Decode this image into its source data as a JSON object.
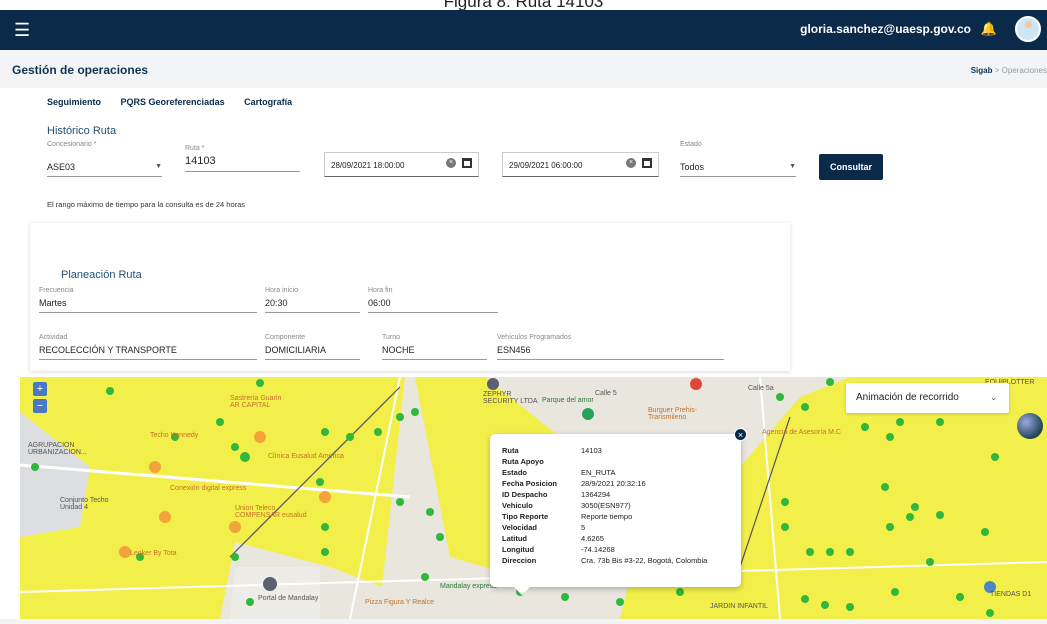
{
  "caption": "Figura 8. Ruta 14103",
  "topbar": {
    "user_email": "gloria.sanchez@uaesp.gov.co"
  },
  "header": {
    "title": "Gestión de operaciones",
    "breadcrumb_root": "Sigab",
    "breadcrumb_sep": ">",
    "breadcrumb_current": "Operaciones"
  },
  "tabs": [
    "Seguimiento",
    "PQRS Georeferenciadas",
    "Cartografía"
  ],
  "section_title": "Histórico Ruta",
  "form": {
    "concesionario_label": "Concesionario *",
    "concesionario_value": "ASE03",
    "ruta_label": "Ruta *",
    "ruta_value": "14103",
    "fecha_inicio": "28/09/2021 18:00:00",
    "fecha_fin": "29/09/2021 06:00:00",
    "estado_label": "Estado",
    "estado_value": "Todos",
    "consultar_label": "Consultar"
  },
  "note": "El rango máximo de tiempo para la consulta es de 24 horas",
  "planeacion": {
    "title": "Planeación Ruta",
    "frecuencia_label": "Frecuencia",
    "frecuencia_value": "Martes",
    "hora_inicio_label": "Hora inicio",
    "hora_inicio_value": "20:30",
    "hora_fin_label": "Hora fin",
    "hora_fin_value": "06:00",
    "actividad_label": "Actividad",
    "actividad_value": "RECOLECCIÓN Y TRANSPORTE",
    "componente_label": "Componente",
    "componente_value": "DOMICILIARIA",
    "turno_label": "Turno",
    "turno_value": "NOCHE",
    "vehiculos_label": "Vehículos Programados",
    "vehiculos_value": "ESN456"
  },
  "map": {
    "zoom_in": "+",
    "zoom_out": "−",
    "animacion_label": "Animación de recorrido",
    "labels": {
      "agrupacion": "AGRUPACION\nURBANIZACION...",
      "techo_kennedy": "Techo Kennedy",
      "conjunto": "Conjunto Techo\nUnidad 4",
      "leoker": "Leoker By Tota",
      "clinica": "Clínica Eusalud America",
      "sastreria": "Sastrería Guarin\nAR CAPITAL",
      "zephyr": "ZEPHYR\nSECURITY LTDA",
      "parque": "Parque del amor",
      "burguer": "Burguer Prehis-\nTransmileno",
      "calle5a": "Calle 5a",
      "agencia": "Agencia de Asesoría M.C",
      "calle5": "Calle 5",
      "portal": "Portal de Mandalay",
      "mandalay": "Mandalay express",
      "pizza": "Pizza Figura Y Realce",
      "jardin": "JARDIN INFANTIL",
      "tiendas": "TIENDAS D1",
      "equiplotter": "EQUIPLOTTER",
      "union": "Union Teleco\nCOMPENSAR eusalud",
      "conexion": "Conexión digital express"
    },
    "popup": {
      "rows": [
        [
          "Ruta",
          "14103"
        ],
        [
          "Ruta Apoyo",
          ""
        ],
        [
          "Estado",
          "EN_RUTA"
        ],
        [
          "Fecha Posicion",
          "28/9/2021 20:32:16"
        ],
        [
          "ID Despacho",
          "1364294"
        ],
        [
          "Vehiculo",
          "3050(ESN977)"
        ],
        [
          "Tipo Reporte",
          "Reporte tiempo"
        ],
        [
          "Velocidad",
          "5"
        ],
        [
          "Latitud",
          "4.6265"
        ],
        [
          "Longitud",
          "-74.14268"
        ],
        [
          "Direccion",
          "Cra. 73b Bis #3-22, Bogotá, Colombia"
        ]
      ]
    }
  }
}
